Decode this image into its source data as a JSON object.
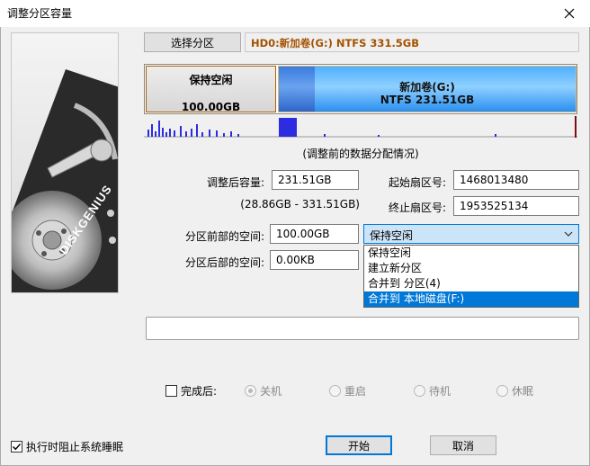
{
  "window": {
    "title": "调整分区容量"
  },
  "brand": {
    "name": "DISKGENIUS"
  },
  "toolbar": {
    "select_partition_label": "选择分区"
  },
  "disk": {
    "info": "HD0:新加卷(G:) NTFS 331.5GB"
  },
  "partition_bar": {
    "free": {
      "title": "保持空闲",
      "size": "100.00GB"
    },
    "volume": {
      "title": "新加卷(G:)",
      "detail": "NTFS 231.51GB"
    }
  },
  "distribution": {
    "caption": "(调整前的数据分配情况)",
    "colors": {
      "bar": "#2c2ce0",
      "marker": "#7a1010"
    }
  },
  "form": {
    "new_size_label": "调整后容量:",
    "new_size_value": "231.51GB",
    "size_range": "(28.86GB - 331.51GB)",
    "start_sector_label": "起始扇区号:",
    "start_sector_value": "1468013480",
    "end_sector_label": "终止扇区号:",
    "end_sector_value": "1953525134",
    "before_space_label": "分区前部的空间:",
    "before_space_value": "100.00GB",
    "after_space_label": "分区后部的空间:",
    "after_space_value": "0.00KB"
  },
  "combo": {
    "selected": "保持空闲",
    "options": [
      "保持空闲",
      "建立新分区",
      "合并到 分区(4)",
      "合并到 本地磁盘(F:)"
    ],
    "highlighted_index": 3
  },
  "completion": {
    "label": "完成后:",
    "checked": false,
    "options": [
      "关机",
      "重启",
      "待机",
      "休眠"
    ],
    "selected_index": 0
  },
  "footer": {
    "prevent_sleep_label": "执行时阻止系统睡眠",
    "prevent_sleep_checked": true,
    "start_label": "开始",
    "cancel_label": "取消"
  },
  "accent_color": "#0078d7"
}
